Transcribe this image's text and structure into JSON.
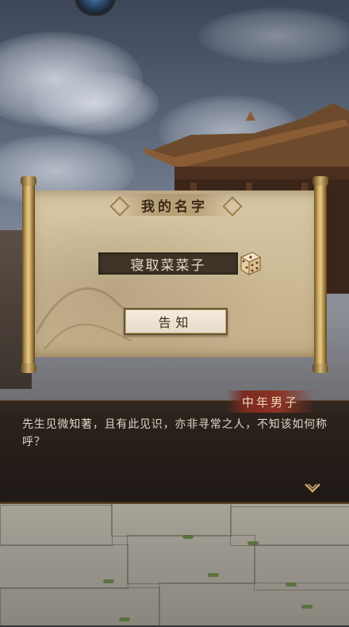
{
  "name_panel": {
    "title": "我的名字",
    "name_value": "寝取菜菜子",
    "dice_icon": "dice-icon",
    "confirm_label": "告知"
  },
  "dialog": {
    "speaker": "中年男子",
    "text": "先生见微知著，且有此见识，亦非寻常之人，不知该如何称呼？",
    "next_icon": "chevron-down-icon"
  },
  "top": {
    "icon": "settings-gear-icon"
  },
  "colors": {
    "paper": "#cdbb96",
    "name_field": "#3e3528",
    "speaker_tag": "#8e3325",
    "dialog_bg": "#2e221a"
  }
}
